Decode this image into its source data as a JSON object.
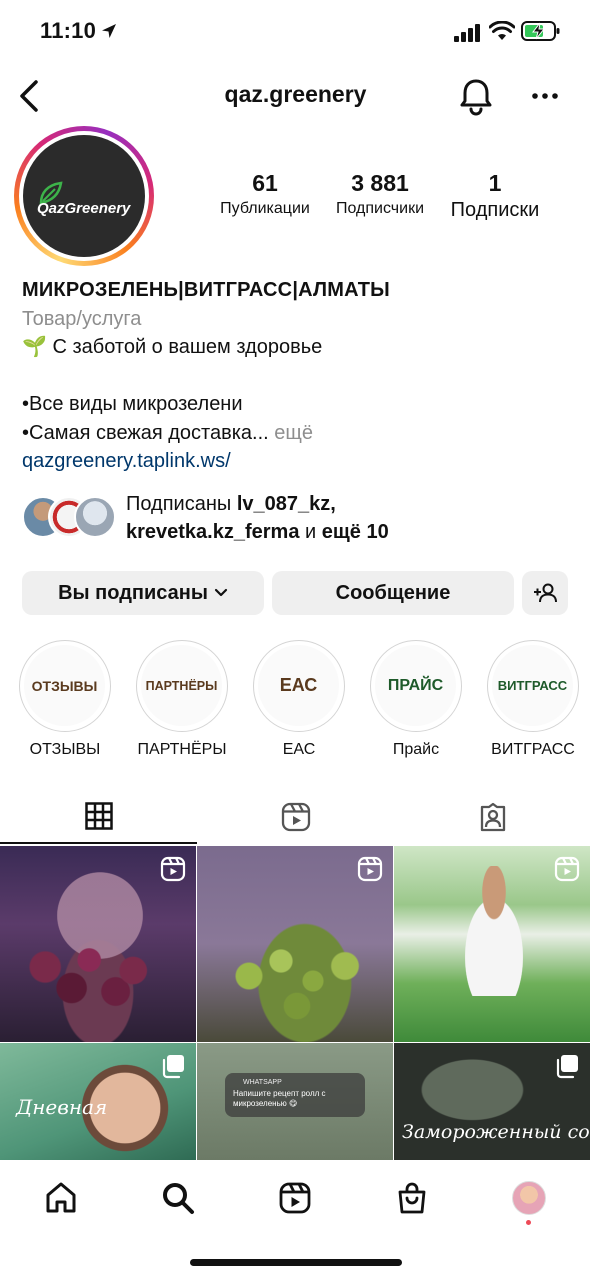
{
  "status_bar": {
    "time": "11:10",
    "icons": [
      "location-arrow-icon",
      "signal-icon",
      "wifi-icon",
      "battery-charging-icon"
    ]
  },
  "header": {
    "username": "qaz.greenery",
    "icons": [
      "back-arrow-icon",
      "bell-icon",
      "more-icon"
    ]
  },
  "profile": {
    "avatar_text": "QazGreenery",
    "stats": [
      {
        "value": "61",
        "label": "Публикации"
      },
      {
        "value": "3 881",
        "label": "Подписчики"
      },
      {
        "value": "1",
        "label": "Подписки"
      }
    ],
    "bio": {
      "name": "МИКРОЗЕЛЕНЬ|ВИТГРАСС|АЛМАТЫ",
      "category": "Товар/услуга",
      "line1": "🌱 С заботой о вашем здоровье",
      "line2": "•Все виды микрозелени",
      "line3": "•Самая свежая доставка...",
      "more": "ещё",
      "link": "qazgreenery.taplink.ws/"
    },
    "followed_by": {
      "prefix": "Подписаны",
      "user1": "lv_087_kz,",
      "user2": "krevetka.kz_ferma",
      "middle": "и",
      "suffix": "ещё 10"
    }
  },
  "actions": {
    "following_label": "Вы подписаны",
    "message_label": "Сообщение"
  },
  "highlights": [
    {
      "cover": "ОТЗЫВЫ",
      "label": "ОТЗЫВЫ",
      "color": "#5a3a1e"
    },
    {
      "cover": "ПАРТНЁРЫ",
      "label": "ПАРТНЁРЫ",
      "color": "#5a3a1e"
    },
    {
      "cover": "ЕАС",
      "label": "ЕАС",
      "color": "#5a3a1e"
    },
    {
      "cover": "ПРАЙС",
      "label": "Прайс",
      "color": "#1e5a2a"
    },
    {
      "cover": "ВИТГРАСС",
      "label": "ВИТГРАСС",
      "color": "#1e5a2a"
    }
  ],
  "tabs": [
    "grid-icon",
    "reels-icon",
    "tagged-icon"
  ],
  "grid": {
    "posts": [
      {
        "type": "reel"
      },
      {
        "type": "reel"
      },
      {
        "type": "reel"
      },
      {
        "type": "carousel",
        "overlay_text": "Дневная"
      },
      {
        "type": "carousel",
        "notification_app": "WHATSAPP",
        "notification_text": "Напишите рецепт ролл с микрозеленью 😋"
      },
      {
        "type": "carousel",
        "overlay_text": "Замороженный сок"
      }
    ]
  },
  "bottom_nav": [
    "home-icon",
    "search-icon",
    "reels-icon",
    "shop-icon",
    "profile-avatar"
  ],
  "colors": {
    "link": "#00376b",
    "secondary_text": "#8e8e8e",
    "button_bg": "#efefef",
    "notification_dot": "#ed4956"
  }
}
